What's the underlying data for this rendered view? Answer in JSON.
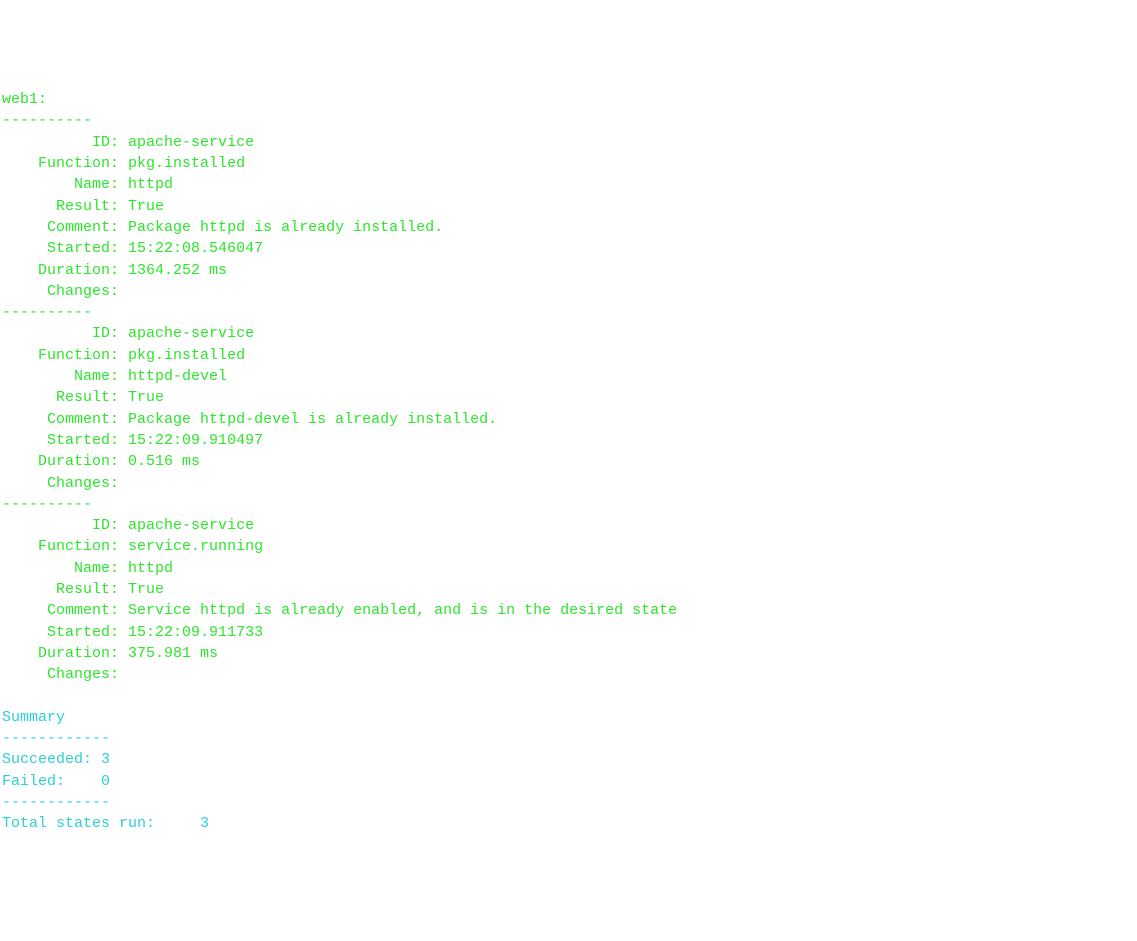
{
  "host": "web1:",
  "sep10": "----------",
  "sep12": "------------",
  "labels": {
    "id": "ID:",
    "function": "Function:",
    "name": "Name:",
    "result": "Result:",
    "comment": "Comment:",
    "started": "Started:",
    "duration": "Duration:",
    "changes": "Changes:"
  },
  "states": [
    {
      "id": "apache-service",
      "function": "pkg.installed",
      "name": "httpd",
      "result": "True",
      "comment": "Package httpd is already installed.",
      "started": "15:22:08.546047",
      "duration": "1364.252 ms",
      "changes": ""
    },
    {
      "id": "apache-service",
      "function": "pkg.installed",
      "name": "httpd-devel",
      "result": "True",
      "comment": "Package httpd-devel is already installed.",
      "started": "15:22:09.910497",
      "duration": "0.516 ms",
      "changes": ""
    },
    {
      "id": "apache-service",
      "function": "service.running",
      "name": "httpd",
      "result": "True",
      "comment": "Service httpd is already enabled, and is in the desired state",
      "started": "15:22:09.911733",
      "duration": "375.981 ms",
      "changes": ""
    }
  ],
  "summary": {
    "heading": "Summary",
    "succeeded_label": "Succeeded:",
    "succeeded": "3",
    "failed_label": "Failed:",
    "failed": "0",
    "total_label": "Total states run:",
    "total": "3"
  }
}
